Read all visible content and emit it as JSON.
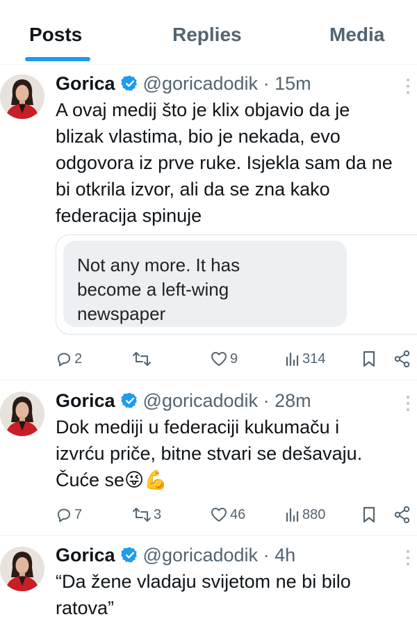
{
  "tabs": [
    {
      "label": "Posts",
      "active": true
    },
    {
      "label": "Replies",
      "active": false
    },
    {
      "label": "Media",
      "active": false
    }
  ],
  "colors": {
    "accent": "#1d9bf0",
    "text": "#0f1419",
    "muted": "#536471"
  },
  "posts": [
    {
      "name": "Gorica",
      "handle": "@goricadodik",
      "sep": "·",
      "time": "15m",
      "text": "A ovaj medij što je klix objavio da je\nblizak vlastima, bio je nekada, evo\nodgovora iz prve ruke. Isjekla sam da ne\nbi otkrila izvor, ali da se zna kako\nfederacija spinuje",
      "image_text": "Not any more. It has\nbecome a left-wing\nnewspaper",
      "stats": {
        "replies": "2",
        "reposts": "",
        "likes": "9",
        "views": "314"
      }
    },
    {
      "name": "Gorica",
      "handle": "@goricadodik",
      "sep": "·",
      "time": "28m",
      "text": "Dok mediji u federaciji kukumaču i\nizvrću priče, bitne stvari se dešavaju.\nČuće se😜💪",
      "stats": {
        "replies": "7",
        "reposts": "3",
        "likes": "46",
        "views": "880"
      }
    },
    {
      "name": "Gorica",
      "handle": "@goricadodik",
      "sep": "·",
      "time": "4h",
      "text": "“Da žene vladaju svijetom ne bi bilo\nratova”"
    }
  ],
  "icons": [
    "verified-badge-icon",
    "more-icon",
    "reply-icon",
    "repost-icon",
    "like-icon",
    "views-icon",
    "bookmark-icon",
    "share-icon"
  ]
}
